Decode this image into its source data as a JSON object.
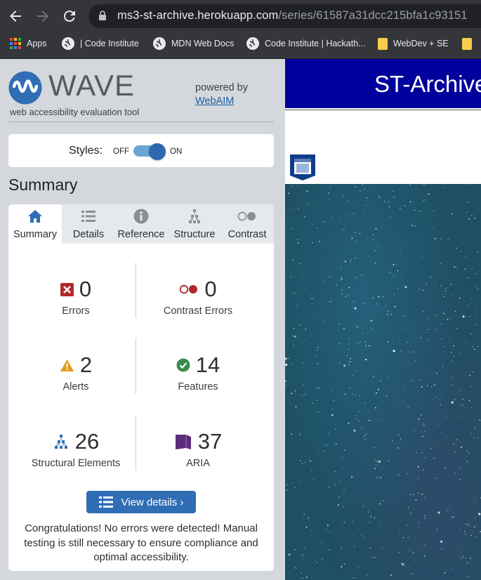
{
  "browser": {
    "url_host": "ms3-st-archive.herokuapp.com",
    "url_path": "/series/61587a31dcc215bfa1c93151",
    "bookmarks": [
      {
        "label": "Apps",
        "icon": "apps-grid-icon"
      },
      {
        "label": "| Code Institute",
        "icon": "globe-icon"
      },
      {
        "label": "MDN Web Docs",
        "icon": "globe-icon"
      },
      {
        "label": "Code Institute | Hackath...",
        "icon": "globe-icon"
      },
      {
        "label": "WebDev + SE",
        "icon": "folder-icon"
      }
    ]
  },
  "wave": {
    "brand": "WAVE",
    "tagline": "web accessibility evaluation tool",
    "powered_by": "powered by",
    "powered_link": "WebAIM",
    "styles_label": "Styles:",
    "styles_off": "OFF",
    "styles_on": "ON",
    "styles_enabled": true,
    "heading": "Summary",
    "tabs": [
      {
        "label": "Summary",
        "icon": "home-icon",
        "active": true
      },
      {
        "label": "Details",
        "icon": "list-icon",
        "active": false
      },
      {
        "label": "Reference",
        "icon": "info-icon",
        "active": false
      },
      {
        "label": "Structure",
        "icon": "structure-icon",
        "active": false
      },
      {
        "label": "Contrast",
        "icon": "contrast-icon",
        "active": false
      }
    ],
    "stats": {
      "errors": {
        "count": "0",
        "label": "Errors"
      },
      "contrast": {
        "count": "0",
        "label": "Contrast Errors"
      },
      "alerts": {
        "count": "2",
        "label": "Alerts"
      },
      "features": {
        "count": "14",
        "label": "Features"
      },
      "structural": {
        "count": "26",
        "label": "Structural Elements"
      },
      "aria": {
        "count": "37",
        "label": "ARIA"
      }
    },
    "view_details": "View details ›",
    "message": "Congratulations! No errors were detected! Manual testing is still necessary to ensure compliance and optimal accessibility."
  },
  "page": {
    "title": "ST-Archive"
  },
  "colors": {
    "error": "#b3262e",
    "alert": "#e39a1a",
    "feature": "#3b8a4e",
    "structural": "#2f6db5",
    "aria": "#5b2d7a",
    "header": "#00009c"
  }
}
